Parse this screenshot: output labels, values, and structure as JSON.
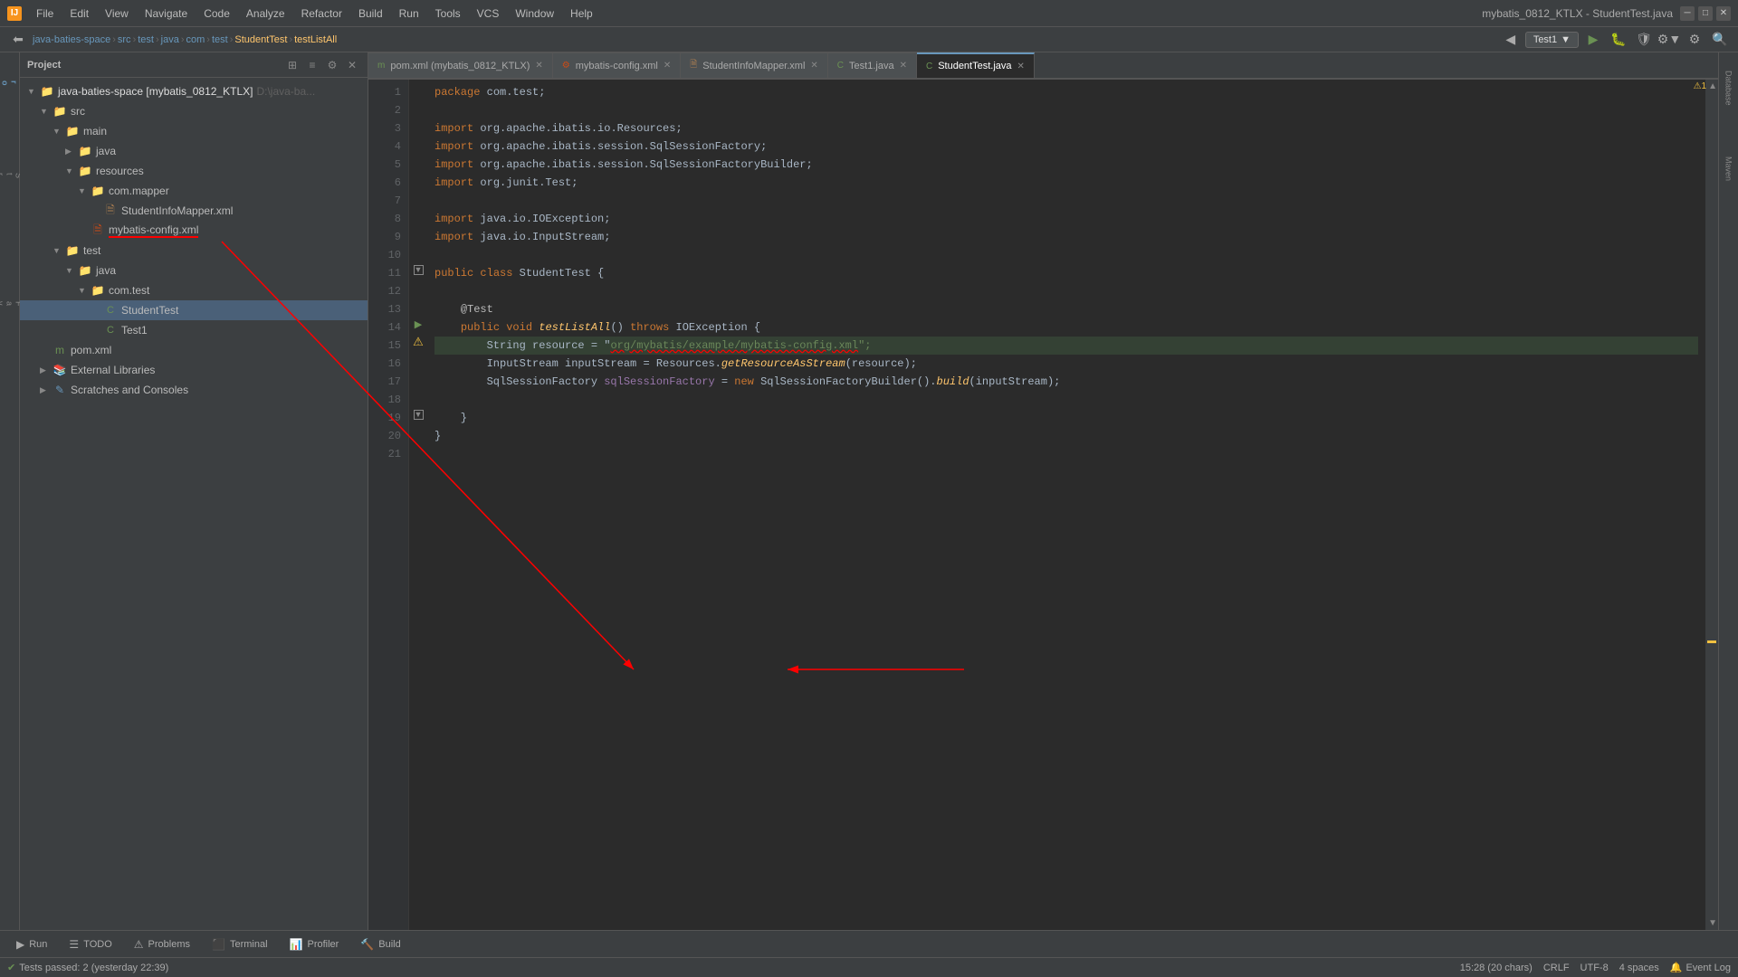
{
  "window": {
    "title": "mybatis_0812_KTLX - StudentTest.java",
    "icon": "IJ"
  },
  "menu": {
    "items": [
      "File",
      "Edit",
      "View",
      "Navigate",
      "Code",
      "Analyze",
      "Refactor",
      "Build",
      "Run",
      "Tools",
      "VCS",
      "Window",
      "Help"
    ]
  },
  "breadcrumb": {
    "project": "java-baties-space",
    "src": "src",
    "test": "test",
    "java": "java",
    "com": "com",
    "test2": "test",
    "class": "StudentTest",
    "method": "testListAll"
  },
  "tabs": [
    {
      "label": "pom.xml (mybatis_0812_KTLX)",
      "icon": "m",
      "active": false
    },
    {
      "label": "mybatis-config.xml",
      "icon": "xml",
      "active": false
    },
    {
      "label": "StudentInfoMapper.xml",
      "icon": "xml",
      "active": false
    },
    {
      "label": "Test1.java",
      "icon": "T",
      "active": false
    },
    {
      "label": "StudentTest.java",
      "icon": "T",
      "active": true
    }
  ],
  "project_panel": {
    "title": "Project",
    "root": "java-baties-space [mybatis_0812_KTLX]",
    "root_path": "D:\\java-ba...",
    "tree": [
      {
        "level": 0,
        "label": "java-baties-space [mybatis_0812_KTLX]",
        "type": "project",
        "expanded": true,
        "path": "D:\\java-ba..."
      },
      {
        "level": 1,
        "label": "src",
        "type": "folder",
        "expanded": true
      },
      {
        "level": 2,
        "label": "main",
        "type": "folder",
        "expanded": true
      },
      {
        "level": 3,
        "label": "java",
        "type": "folder",
        "expanded": false
      },
      {
        "level": 3,
        "label": "resources",
        "type": "folder",
        "expanded": true
      },
      {
        "level": 4,
        "label": "com.mapper",
        "type": "folder",
        "expanded": true
      },
      {
        "level": 5,
        "label": "StudentInfoMapper.xml",
        "type": "xml"
      },
      {
        "level": 4,
        "label": "mybatis-config.xml",
        "type": "xml_red"
      },
      {
        "level": 2,
        "label": "test",
        "type": "folder",
        "expanded": true
      },
      {
        "level": 3,
        "label": "java",
        "type": "folder",
        "expanded": true
      },
      {
        "level": 4,
        "label": "com.test",
        "type": "folder",
        "expanded": true
      },
      {
        "level": 5,
        "label": "StudentTest",
        "type": "java_test",
        "selected": true
      },
      {
        "level": 5,
        "label": "Test1",
        "type": "java_test"
      },
      {
        "level": 1,
        "label": "pom.xml",
        "type": "pom"
      },
      {
        "level": 1,
        "label": "External Libraries",
        "type": "libs"
      },
      {
        "level": 1,
        "label": "Scratches and Consoles",
        "type": "scratches"
      }
    ]
  },
  "code": {
    "lines": [
      {
        "num": 1,
        "content": "package com.test;",
        "tokens": [
          {
            "t": "kw",
            "v": "package"
          },
          {
            "t": "plain",
            "v": " com.test;"
          }
        ]
      },
      {
        "num": 2,
        "content": ""
      },
      {
        "num": 3,
        "content": "import org.apache.ibatis.io.Resources;",
        "tokens": [
          {
            "t": "kw",
            "v": "import"
          },
          {
            "t": "plain",
            "v": " org.apache.ibatis.io.Resources;"
          }
        ]
      },
      {
        "num": 4,
        "content": "import org.apache.ibatis.session.SqlSessionFactory;",
        "tokens": [
          {
            "t": "kw",
            "v": "import"
          },
          {
            "t": "plain",
            "v": " org.apache.ibatis.session.SqlSessionFactory;"
          }
        ]
      },
      {
        "num": 5,
        "content": "import org.apache.ibatis.session.SqlSessionFactoryBuilder;",
        "tokens": [
          {
            "t": "kw",
            "v": "import"
          },
          {
            "t": "plain",
            "v": " org.apache.ibatis.session.SqlSessionFactoryBuilder;"
          }
        ]
      },
      {
        "num": 6,
        "content": "import org.junit.Test;",
        "tokens": [
          {
            "t": "kw",
            "v": "import"
          },
          {
            "t": "plain",
            "v": " org.junit.Test;"
          }
        ]
      },
      {
        "num": 7,
        "content": ""
      },
      {
        "num": 8,
        "content": "import java.io.IOException;",
        "tokens": [
          {
            "t": "kw",
            "v": "import"
          },
          {
            "t": "plain",
            "v": " java.io.IOException;"
          }
        ]
      },
      {
        "num": 9,
        "content": "import java.io.InputStream;",
        "tokens": [
          {
            "t": "kw",
            "v": "import"
          },
          {
            "t": "plain",
            "v": " java.io.InputStream;"
          }
        ]
      },
      {
        "num": 10,
        "content": ""
      },
      {
        "num": 11,
        "content": "public class StudentTest {"
      },
      {
        "num": 12,
        "content": ""
      },
      {
        "num": 13,
        "content": "    @Test"
      },
      {
        "num": 14,
        "content": "    public void testListAll() throws IOException {"
      },
      {
        "num": 15,
        "content": "        String resource = \"org/mybatis/example/mybatis-config.xml\";"
      },
      {
        "num": 16,
        "content": "        InputStream inputStream = Resources.getResourceAsStream(resource);"
      },
      {
        "num": 17,
        "content": "        SqlSessionFactory sqlSessionFactory = new SqlSessionFactoryBuilder().build(inputStream);"
      },
      {
        "num": 18,
        "content": ""
      },
      {
        "num": 19,
        "content": "    }"
      },
      {
        "num": 20,
        "content": "}"
      },
      {
        "num": 21,
        "content": ""
      }
    ]
  },
  "bottom_tabs": [
    {
      "label": "Run",
      "icon": "▶"
    },
    {
      "label": "TODO",
      "icon": "☰"
    },
    {
      "label": "Problems",
      "icon": "⚠"
    },
    {
      "label": "Terminal",
      "icon": "⬛"
    },
    {
      "label": "Profiler",
      "icon": "📊"
    },
    {
      "label": "Build",
      "icon": "🔨"
    }
  ],
  "status_bar": {
    "left": {
      "tests_passed": "Tests passed: 2 (yesterday 22:39)"
    },
    "right": {
      "position": "15:28 (20 chars)",
      "line_sep": "CRLF",
      "encoding": "UTF-8",
      "indent": "4 spaces",
      "event_log": "Event Log"
    }
  },
  "run_config": "Test1",
  "right_panels": [
    "Database",
    "Maven"
  ]
}
